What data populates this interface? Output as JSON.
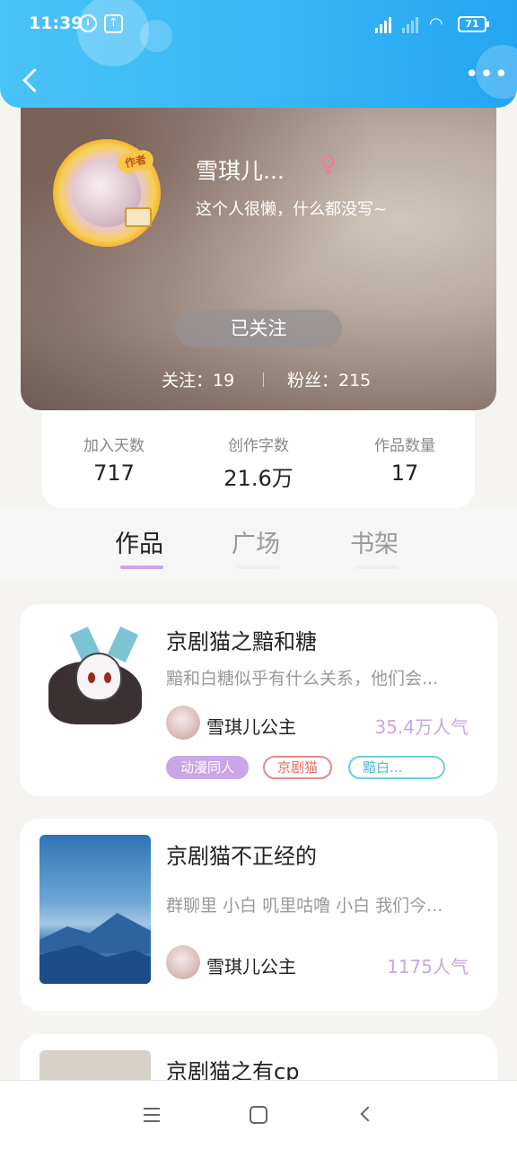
{
  "status_bar": {
    "time": "11:39",
    "battery": "71",
    "upload_glyph": "↑"
  },
  "header": {
    "more_glyph": "•••"
  },
  "profile": {
    "author_badge": "作者",
    "username": "雪琪儿...",
    "gender_glyph": "♀",
    "bio": "这个人很懒，什么都没写~",
    "follow_button": "已关注",
    "following": "关注：19",
    "fans": "粉丝：215"
  },
  "stats": [
    {
      "label": "加入天数",
      "value": "717"
    },
    {
      "label": "创作字数",
      "value": "21.6万"
    },
    {
      "label": "作品数量",
      "value": "17"
    }
  ],
  "tabs": [
    {
      "label": "作品",
      "active": true
    },
    {
      "label": "广场",
      "active": false
    },
    {
      "label": "书架",
      "active": false
    }
  ],
  "works": [
    {
      "title": "京剧猫之黯和糖",
      "desc": "黯和白糖似乎有什么关系，他们会...",
      "author": "雪琪儿公主",
      "popularity": "35.4万人气",
      "tags": [
        "动漫同人",
        "京剧猫",
        "黯白..."
      ]
    },
    {
      "title": "京剧猫不正经的",
      "desc": "群聊里 小白 叽里咕噜 小白 我们今...",
      "author": "雪琪儿公主",
      "popularity": "1175人气"
    },
    {
      "title": "京剧猫之有cp"
    }
  ],
  "icons": {
    "back": "chevron-left-icon",
    "more": "more-dots-icon",
    "gender": "female-icon"
  },
  "colors": {
    "header_blue": "#39b8f5",
    "accent_purple": "#c9a6e6",
    "gender_pink": "#f07aa0"
  }
}
